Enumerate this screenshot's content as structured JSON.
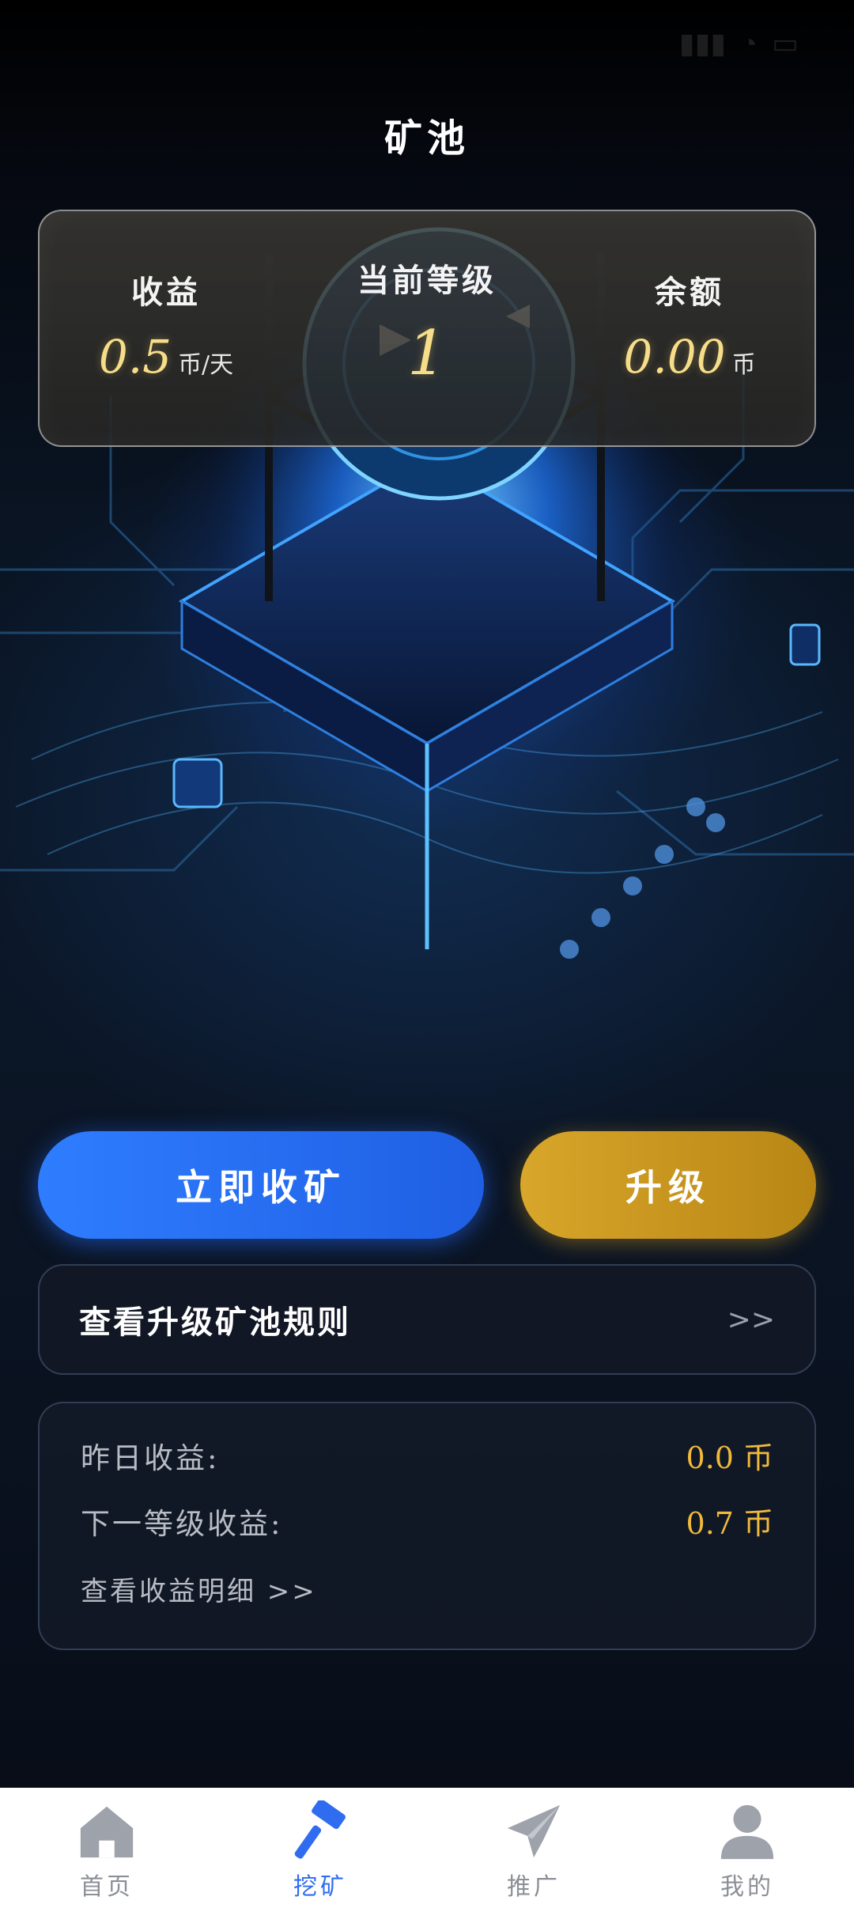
{
  "status_bar": {
    "time": "",
    "icons": [
      "signal-icon",
      "wifi-icon",
      "battery-icon"
    ]
  },
  "page": {
    "title": "矿池"
  },
  "stats": {
    "income": {
      "label": "收益",
      "value": "0.5",
      "unit": "币/天"
    },
    "level": {
      "label": "当前等级",
      "value": "1"
    },
    "balance": {
      "label": "余额",
      "value": "0.00",
      "unit": "币"
    }
  },
  "actions": {
    "collect_label": "立即收矿",
    "upgrade_label": "升级"
  },
  "rules": {
    "label": "查看升级矿池规则",
    "arrow": ">>"
  },
  "earnings": {
    "yesterday_label": "昨日收益:",
    "yesterday_value": "0.0",
    "yesterday_unit": "币",
    "next_level_label": "下一等级收益:",
    "next_level_value": "0.7",
    "next_level_unit": "币",
    "detail_link": "查看收益明细 >>"
  },
  "tabbar": {
    "items": [
      {
        "label": "首页",
        "icon": "home-icon",
        "active": false
      },
      {
        "label": "挖矿",
        "icon": "hammer-icon",
        "active": true
      },
      {
        "label": "推广",
        "icon": "paper-plane-icon",
        "active": false
      },
      {
        "label": "我的",
        "icon": "user-icon",
        "active": false
      }
    ]
  },
  "colors": {
    "accent_blue": "#2f7dff",
    "accent_gold": "#d8a62a",
    "value_gold": "#f0b93a",
    "tab_active": "#2f6cf0",
    "tab_inactive": "#8c8f96"
  }
}
